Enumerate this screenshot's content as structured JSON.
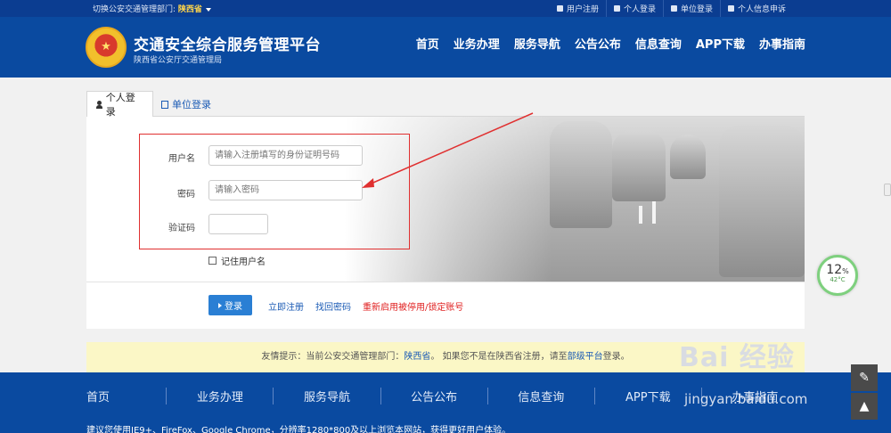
{
  "topbar": {
    "dept_label": "切换公安交通管理部门: ",
    "dept_value": "陕西省",
    "links": [
      "用户注册",
      "个人登录",
      "单位登录",
      "个人信息申诉"
    ]
  },
  "header": {
    "title": "交通安全综合服务管理平台",
    "subtitle": "陕西省公安厅交通管理局",
    "nav": [
      "首页",
      "业务办理",
      "服务导航",
      "公告公布",
      "信息查询",
      "APP下载",
      "办事指南"
    ]
  },
  "tabs": {
    "personal": "个人登录",
    "unit": "单位登录"
  },
  "form": {
    "username_label": "用户名",
    "username_placeholder": "请输入注册填写的身份证明号码",
    "password_label": "密码",
    "password_placeholder": "请输入密码",
    "captcha_label": "验证码",
    "remember_label": "记住用户名",
    "login_button": "登录",
    "register_link": "立即注册",
    "recover_link": "找回密码",
    "reactivate_link": "重新启用被停用/锁定账号"
  },
  "notice": {
    "prefix": "友情提示：当前公安交通管理部门：",
    "dept": "陕西省",
    "suffix": "。 如果您不是在陕西省注册，请至",
    "link": "部级平台",
    "end": "登录。"
  },
  "footer": {
    "nav": [
      "首页",
      "业务办理",
      "服务导航",
      "公告公布",
      "信息查询",
      "APP下载",
      "办事指南"
    ],
    "note": "建议您使用IE9+、FireFox、Google Chrome，分辨率1280*800及以上浏览本网站，获得更好用户体验。"
  },
  "overlay": {
    "gauge_value": "12",
    "gauge_unit": "%",
    "gauge_temp": "42°C",
    "watermark": "Bai 经验",
    "watermark_url": "jingyan.baidu.com"
  },
  "colors": {
    "header_blue": "#0a4aa0",
    "topbar_blue": "#0b3d91",
    "annotation_red": "#e03030",
    "link_blue": "#1b5bb5"
  }
}
